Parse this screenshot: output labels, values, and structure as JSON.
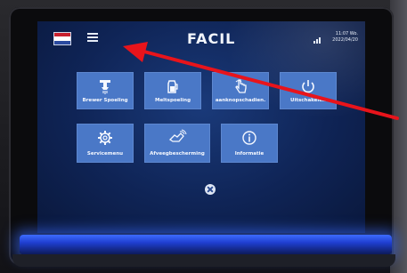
{
  "device": {
    "logo": "FACIL",
    "clock": {
      "time": "11:07 Wo.",
      "date": "2022/04/20"
    },
    "flag_colors": [
      "#c8202d",
      "#ffffff",
      "#2a4aa0"
    ],
    "accent": "#4a78c7",
    "menu_icon": "hamburger-icon"
  },
  "tiles": [
    {
      "label": "Brewer Spoeling",
      "icon": "faucet-icon"
    },
    {
      "label": "Meltspoeling",
      "icon": "milk-jug-icon"
    },
    {
      "label": "aanknopschadien.",
      "icon": "touch-hand-icon"
    },
    {
      "label": "Uitschakelen",
      "icon": "power-icon"
    },
    {
      "label": "Servicemenu",
      "icon": "gear-icon"
    },
    {
      "label": "Afveegbescherming",
      "icon": "wipe-hand-icon"
    },
    {
      "label": "Informatie",
      "icon": "info-icon"
    }
  ],
  "close_icon": "close-circle-icon",
  "annotation": {
    "arrow_color": "#e8141b"
  }
}
